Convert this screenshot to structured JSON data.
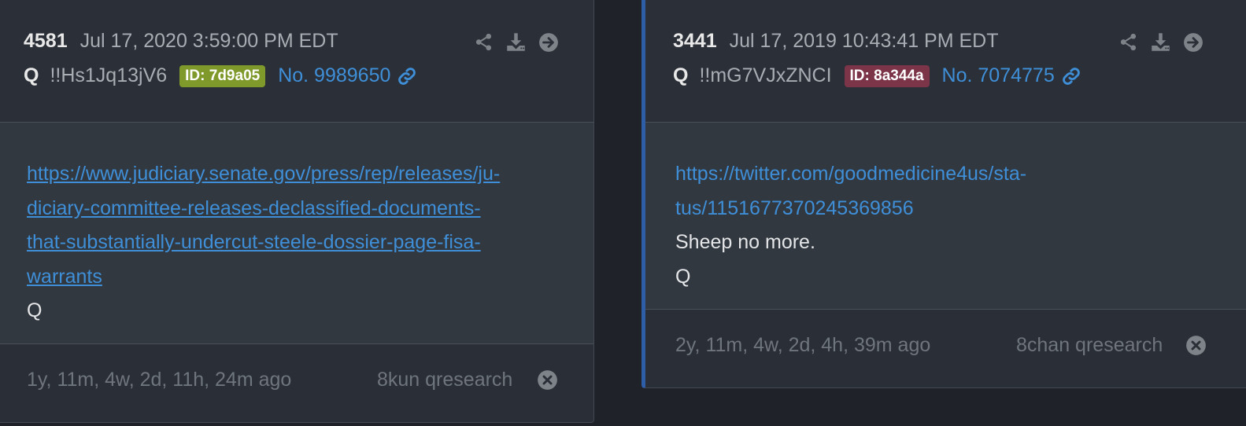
{
  "posts": [
    {
      "number": "4581",
      "date": "Jul 17, 2020 3:59:00 PM EDT",
      "author": "Q",
      "tripcode": "!!Hs1Jq13jV6",
      "id_badge": "ID: 7d9a05",
      "id_color": "#7f9a2b",
      "post_no": "No. 9989650",
      "body_link_lines": [
        "https://www.judiciary.senate.gov/press/rep/releases/ju-",
        "diciary-committee-releases-declassified-documents-",
        "that-substantially-undercut-steele-dossier-page-fisa-",
        "warrants"
      ],
      "body_text_lines": [
        "Q"
      ],
      "age": "1y, 11m, 4w, 2d, 11h, 24m ago",
      "source": "8kun qresearch"
    },
    {
      "number": "3441",
      "date": "Jul 17, 2019 10:43:41 PM EDT",
      "author": "Q",
      "tripcode": "!!mG7VJxZNCI",
      "id_badge": "ID: 8a344a",
      "id_color": "#7c3449",
      "post_no": "No. 7074775",
      "body_link_lines": [
        "https://twitter.com/goodmedicine4us/sta-",
        "tus/1151677370245369856"
      ],
      "body_text_lines": [
        "Sheep no more.",
        "Q"
      ],
      "age": "2y, 11m, 4w, 2d, 4h, 39m ago",
      "source": "8chan qresearch"
    }
  ],
  "icons": {
    "share": "share-icon",
    "download": "download-icon",
    "goto": "arrow-circle-right-icon",
    "link": "chain-link-icon",
    "close": "close-circle-icon"
  },
  "colors": {
    "link": "#3f8fd8",
    "accent_border": "#2f5ea8"
  }
}
